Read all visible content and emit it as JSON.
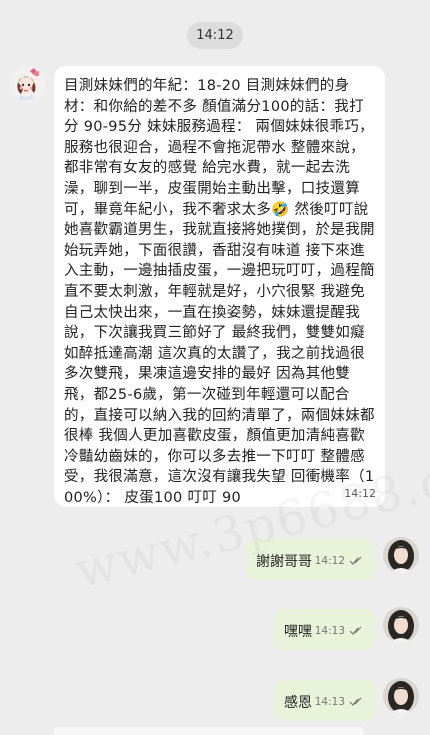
{
  "chat": {
    "date_pill": "14:12",
    "incoming": {
      "text": "目測妹妹們的年紀：18-20 目測妹妹們的身材：和你給的差不多 顏值滿分100的話：我打分 90-95分 妹妹服務過程： 兩個妹妹很乖巧，服務也很迎合，過程不會拖泥帶水 整體來說，都非常有女友的感覺 給完水費，就一起去洗澡，聊到一半，皮蛋開始主動出擊，口技還算可，畢竟年紀小，我不奢求太多🤣 然後叮叮說她喜歡霸道男生，我就直接將她撲倒，於是我開始玩弄她，下面很讚，香甜沒有味道 接下來進入主動，一邊抽插皮蛋，一邊把玩叮叮，過程簡直不要太刺激，年輕就是好，小穴很緊 我避免自己太快出來，一直在換姿勢，妹妹還提醒我說，下次讓我買三節好了 最終我們，雙雙如癡如醉抵達高潮 這次真的太讚了，我之前找過很多次雙飛，果凍這邊安排的最好 因為其他雙飛，都25-6歲，第一次碰到年輕還可以配合的，直接可以納入我的回約清單了，兩個妹妹都很棒 我個人更加喜歡皮蛋，顏值更加清純喜歡冷豔幼齒妹的，你可以多去推一下叮叮 整體感受，我很滿意，這次沒有讓我失望 回衝機率（100%）： 皮蛋100 叮叮 90",
      "time": "14:12"
    },
    "outgoing": [
      {
        "text": "謝謝哥哥",
        "time": "14:12",
        "status_icon": "double-check-icon"
      },
      {
        "text": "嘿嘿",
        "time": "14:13",
        "status_icon": "double-check-icon"
      },
      {
        "text": "感恩",
        "time": "14:13",
        "status_icon": "double-check-icon"
      }
    ],
    "watermark": "www.3p6688.com"
  },
  "colors": {
    "background": "#ededed",
    "incoming_bubble": "#ffffff",
    "outgoing_bubble": "#e9f3d9",
    "date_pill": "#dcdcdc"
  }
}
